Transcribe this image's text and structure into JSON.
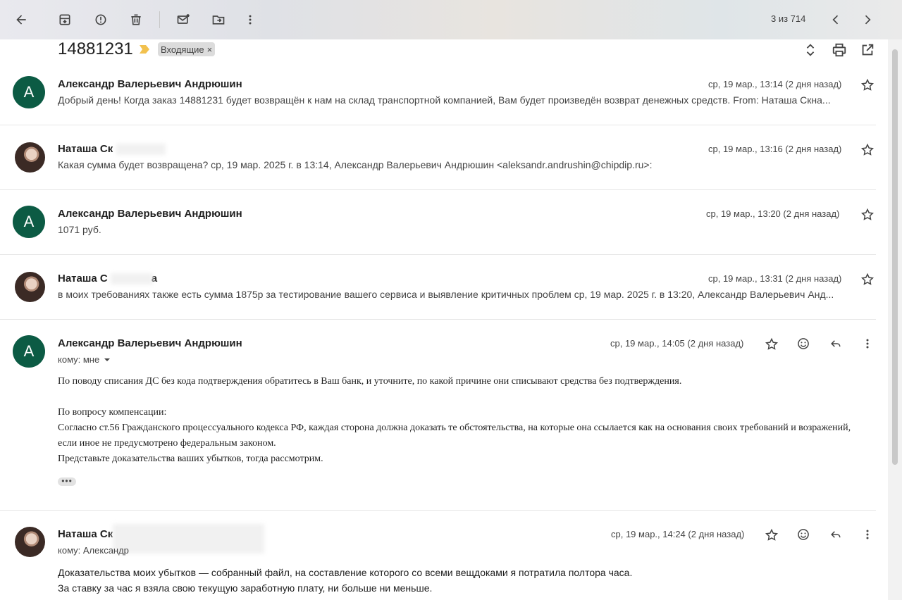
{
  "toolbar": {
    "counter": "3 из 714"
  },
  "subject": {
    "title": "14881231",
    "label_chip": "Входящие",
    "chip_remove": "×"
  },
  "messages": [
    {
      "avatar_letter": "А",
      "sender": "Александр Валерьевич Андрюшин",
      "date": "ср, 19 мар., 13:14 (2 дня назад)",
      "snippet": "Добрый день! Когда заказ 14881231 будет возвращён к нам на склад транспортной компанией, Вам будет произведён возврат денежных средств. From: Наташа Скна..."
    },
    {
      "sender": "Наташа Ск",
      "date": "ср, 19 мар., 13:16 (2 дня назад)",
      "snippet": "Какая сумма будет возвращена? ср, 19 мар. 2025 г. в 13:14, Александр Валерьевич Андрюшин <aleksandr.andrushin@chipdip.ru>:"
    },
    {
      "avatar_letter": "А",
      "sender": "Александр Валерьевич Андрюшин",
      "date": "ср, 19 мар., 13:20 (2 дня назад)",
      "snippet": "1071 руб."
    },
    {
      "sender": "Наташа С",
      "sender_tail": "а",
      "date": "ср, 19 мар., 13:31 (2 дня назад)",
      "snippet": "в моих требованиях также есть сумма 1875р за тестирование вашего сервиса и выявление критичных проблем ср, 19 мар. 2025 г. в 13:20, Александр Валерьевич Анд..."
    },
    {
      "avatar_letter": "А",
      "sender": "Александр Валерьевич Андрюшин",
      "date": "ср, 19 мар., 14:05 (2 дня назад)",
      "to": "кому: мне",
      "body": [
        "По поводу списания ДС без кода подтверждения обратитесь в Ваш банк, и уточните, по какой причине они списывают средства без подтверждения.",
        "",
        "По вопросу компенсации:",
        "Согласно ст.56 Гражданского процессуального кодекса РФ, каждая сторона должна доказать те обстоятельства, на которые она ссылается как на основания своих требований и возражений, если иное не предусмотрено федеральным законом.",
        "Представьте доказательства ваших убытков, тогда рассмотрим."
      ],
      "more": "•••"
    },
    {
      "sender": "Наташа Ск",
      "date": "ср, 19 мар., 14:24 (2 дня назад)",
      "to": "кому: Александр",
      "body": [
        "Доказательства моих убытков — собранный файл, на составление которого со всеми вещдоками я потратила полтора часа.",
        "За ставку за час я взяла свою текущую заработную плату, ни больше ни меньше."
      ]
    }
  ],
  "colors": {
    "avatar_green": "#0c5b44",
    "important_marker": "#f2c14e",
    "chip_bg": "#dcdcdc"
  },
  "icons": [
    "back-arrow-icon",
    "archive-icon",
    "report-spam-icon",
    "delete-icon",
    "mark-unread-icon",
    "move-to-icon",
    "more-vert-icon",
    "chevron-left-icon",
    "chevron-right-icon",
    "expand-collapse-icon",
    "print-icon",
    "open-new-window-icon",
    "star-icon",
    "emoji-icon",
    "reply-icon"
  ]
}
